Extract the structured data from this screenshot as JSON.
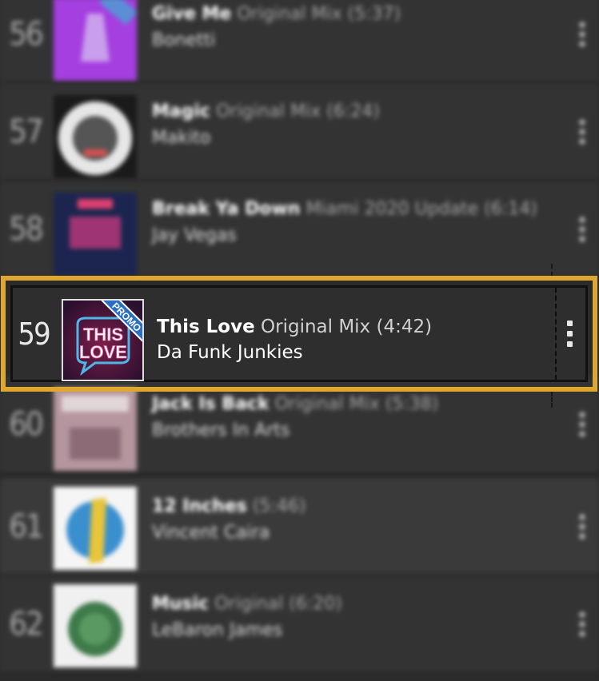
{
  "tracks": [
    {
      "rank": "56",
      "title": "Give Me",
      "mix": "Original Mix (5:37)",
      "artist": "Bonetti"
    },
    {
      "rank": "57",
      "title": "Magic",
      "mix": "Original Mix (6:24)",
      "artist": "Makito"
    },
    {
      "rank": "58",
      "title": "Break Ya Down",
      "mix": "Miami 2020 Update (6:14)",
      "artist": "Jay Vegas"
    },
    {
      "rank": "59",
      "title": "This Love",
      "mix": "Original Mix (4:42)",
      "artist": "Da Funk Junkies",
      "artwork_text": [
        "THIS",
        "LOVE"
      ],
      "badge": "PROMO"
    },
    {
      "rank": "60",
      "title": "Jack Is Back",
      "mix": "Original Mix (5:38)",
      "artist": "Brothers In Arts"
    },
    {
      "rank": "61",
      "title": "12 Inches",
      "mix": "(5:46)",
      "artist": "Vincent Caira"
    },
    {
      "rank": "62",
      "title": "Music",
      "mix": "Original (6:20)",
      "artist": "LeBaron James"
    }
  ],
  "icons": {
    "menu": "more-vertical-icon"
  },
  "colors": {
    "highlight": "#e0a72e",
    "background": "#333333"
  }
}
